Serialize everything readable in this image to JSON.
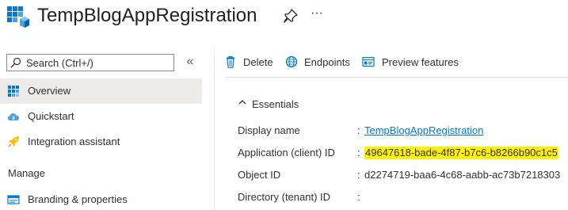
{
  "header": {
    "title": "TempBlogAppRegistration",
    "app_icon": "app-registration-icon",
    "pin_icon": "pin-icon",
    "more_label": "···"
  },
  "sidebar": {
    "search_placeholder": "Search (Ctrl+/)",
    "collapse_label": "«",
    "items": [
      {
        "label": "Overview",
        "icon": "overview-grid-icon",
        "active": true
      },
      {
        "label": "Quickstart",
        "icon": "quickstart-cloud-icon",
        "active": false
      },
      {
        "label": "Integration assistant",
        "icon": "rocket-icon",
        "active": false
      }
    ],
    "section_manage": "Manage",
    "manage_items": [
      {
        "label": "Branding & properties",
        "icon": "branding-icon"
      }
    ]
  },
  "toolbar": {
    "delete_label": "Delete",
    "endpoints_label": "Endpoints",
    "preview_label": "Preview features"
  },
  "essentials": {
    "toggle_label": "Essentials",
    "props": [
      {
        "label": "Display name",
        "value": "TempBlogAppRegistration"
      },
      {
        "label": "Application (client) ID",
        "value": "49647618-bade-4f87-b7c6-b8266b90c1c5"
      },
      {
        "label": "Object ID",
        "value": "d2274719-baa6-4c68-aabb-ac73b7218303"
      },
      {
        "label": "Directory (tenant) ID",
        "value": ""
      }
    ],
    "colon": ":"
  },
  "colors": {
    "link": "#0078d4",
    "highlight": "#fff100",
    "active_nav": "#edebe9",
    "azure_blue": "#0078d4"
  }
}
